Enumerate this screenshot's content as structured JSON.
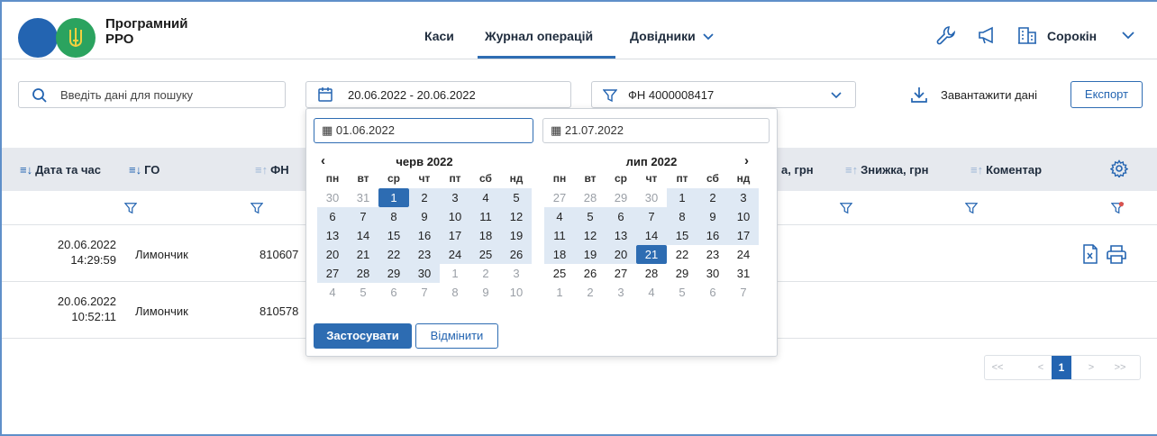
{
  "header": {
    "app_title_line1": "Програмний",
    "app_title_line2": "РРО",
    "logo_emblem": "trident-icon",
    "nav": [
      {
        "label": "Каси",
        "active": false
      },
      {
        "label": "Журнал операцій",
        "active": true
      },
      {
        "label": "Довідники",
        "active": false,
        "has_dropdown": true
      }
    ],
    "user_name": "Сорокін",
    "icons": [
      "wrench-icon",
      "megaphone-icon",
      "building-icon",
      "chevron-down-icon"
    ]
  },
  "toolbar": {
    "search_placeholder": "Введіть дані для пошуку",
    "date_range": "20.06.2022 - 20.06.2022",
    "fn_filter": "ФН 4000008417",
    "download_label": "Завантажити дані",
    "export_label": "Експорт"
  },
  "table": {
    "columns": [
      {
        "label": "Дата та час",
        "sort": "active"
      },
      {
        "label": "ГО",
        "sort": "active"
      },
      {
        "label": "ФН",
        "sort": "inactive"
      },
      {
        "label": "а, грн",
        "sort": "none"
      },
      {
        "label": "Знижка, грн",
        "sort": "inactive"
      },
      {
        "label": "Коментар",
        "sort": "inactive"
      }
    ],
    "rows": [
      {
        "date": "20.06.2022",
        "time": "14:29:59",
        "go": "Лимончик",
        "fn": "810607"
      },
      {
        "date": "20.06.2022",
        "time": "10:52:11",
        "go": "Лимончик",
        "fn": "810578"
      }
    ]
  },
  "pagination": {
    "first": "<<",
    "prev": "<",
    "current": "1",
    "next": ">",
    "last": ">>"
  },
  "datepicker": {
    "start_input": "01.06.2022",
    "end_input": "21.07.2022",
    "weekdays": [
      "пн",
      "вт",
      "ср",
      "чт",
      "пт",
      "сб",
      "нд"
    ],
    "left_month": "черв 2022",
    "right_month": "лип 2022",
    "left_weeks": [
      [
        "30",
        "31",
        "1",
        "2",
        "3",
        "4",
        "5"
      ],
      [
        "6",
        "7",
        "8",
        "9",
        "10",
        "11",
        "12"
      ],
      [
        "13",
        "14",
        "15",
        "16",
        "17",
        "18",
        "19"
      ],
      [
        "20",
        "21",
        "22",
        "23",
        "24",
        "25",
        "26"
      ],
      [
        "27",
        "28",
        "29",
        "30",
        "1",
        "2",
        "3"
      ],
      [
        "4",
        "5",
        "6",
        "7",
        "8",
        "9",
        "10"
      ]
    ],
    "right_weeks": [
      [
        "27",
        "28",
        "29",
        "30",
        "1",
        "2",
        "3"
      ],
      [
        "4",
        "5",
        "6",
        "7",
        "8",
        "9",
        "10"
      ],
      [
        "11",
        "12",
        "13",
        "14",
        "15",
        "16",
        "17"
      ],
      [
        "18",
        "19",
        "20",
        "21",
        "22",
        "23",
        "24"
      ],
      [
        "25",
        "26",
        "27",
        "28",
        "29",
        "30",
        "31"
      ],
      [
        "1",
        "2",
        "3",
        "4",
        "5",
        "6",
        "7"
      ]
    ],
    "apply_label": "Застосувати",
    "cancel_label": "Відмінити"
  },
  "colors": {
    "accent": "#2364b1",
    "range_bg": "#dfe9f4",
    "header_bg": "#e6e9ee",
    "logo_green": "#2ba35f"
  }
}
